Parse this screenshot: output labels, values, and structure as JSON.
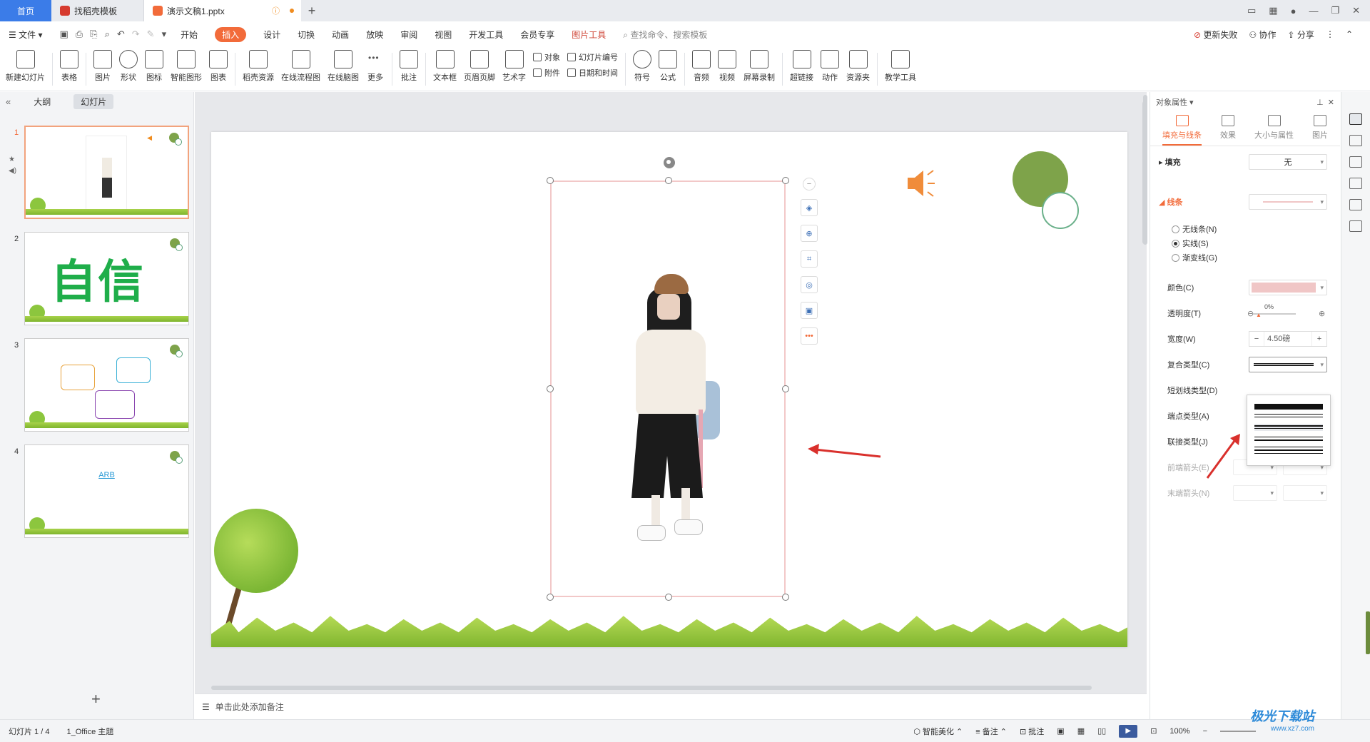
{
  "tabs": {
    "home": "首页",
    "template": "找稻壳模板",
    "document": "演示文稿1.pptx"
  },
  "menu": {
    "file": "文件",
    "items": [
      "开始",
      "插入",
      "设计",
      "切换",
      "动画",
      "放映",
      "审阅",
      "视图",
      "开发工具",
      "会员专享"
    ],
    "active": "插入",
    "picture_tools": "图片工具",
    "search": "查找命令、搜索模板",
    "update_failed": "更新失败",
    "collab": "协作",
    "share": "分享"
  },
  "ribbon": {
    "new_slide": "新建幻灯片",
    "table": "表格",
    "picture": "图片",
    "shape": "形状",
    "icon": "图标",
    "smart_shape": "智能图形",
    "chart": "图表",
    "docer_res": "稻壳资源",
    "online_flow": "在线流程图",
    "online_mind": "在线脑图",
    "more": "更多",
    "comment": "批注",
    "textbox": "文本框",
    "header_footer": "页眉页脚",
    "wordart": "艺术字",
    "object": "对象",
    "attachment": "附件",
    "slide_num": "幻灯片编号",
    "datetime": "日期和时间",
    "symbol": "符号",
    "formula": "公式",
    "audio": "音频",
    "video": "视频",
    "screen_rec": "屏幕录制",
    "hyperlink": "超链接",
    "action": "动作",
    "resource": "资源夹",
    "teach_tools": "教学工具"
  },
  "left_panel": {
    "outline": "大纲",
    "slides": "幻灯片",
    "slide_numbers": [
      "1",
      "2",
      "3",
      "4"
    ],
    "slide2_text": "自信",
    "slide4_text": "ARB"
  },
  "notes_placeholder": "单击此处添加备注",
  "right_panel": {
    "title": "对象属性",
    "tabs": [
      "填充与线条",
      "效果",
      "大小与属性",
      "图片"
    ],
    "fill_label": "填充",
    "fill_value": "无",
    "line_label": "线条",
    "no_line": "无线条(N)",
    "solid_line": "实线(S)",
    "gradient_line": "渐变线(G)",
    "color": "颜色(C)",
    "transparency": "透明度(T)",
    "transparency_value": "0%",
    "width": "宽度(W)",
    "width_value": "4.50磅",
    "compound_type": "复合类型(C)",
    "dash_type": "短划线类型(D)",
    "cap_type": "端点类型(A)",
    "join_type": "联接类型(J)",
    "begin_arrow": "前端箭头(E)",
    "end_arrow": "末端箭头(N)"
  },
  "status": {
    "slide_count": "幻灯片 1 / 4",
    "theme": "1_Office 主题",
    "beautify": "智能美化",
    "notes": "备注",
    "comment": "批注",
    "zoom": "100%"
  },
  "watermark": {
    "title": "极光下载站",
    "url": "www.xz7.com"
  },
  "colors": {
    "accent": "#f26b3a",
    "tab_blue": "#3b7ce8",
    "line_color": "#f0c6c6",
    "green": "#7ea34a"
  }
}
